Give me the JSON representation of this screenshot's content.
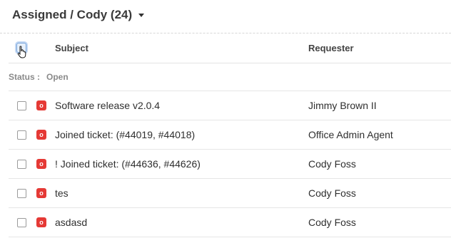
{
  "header": {
    "view_title": "Assigned / Cody (24)"
  },
  "columns": {
    "subject": "Subject",
    "requester": "Requester"
  },
  "group": {
    "label": "Status",
    "separator": ":",
    "value": "Open"
  },
  "rows": [
    {
      "status_badge": "o",
      "subject": "Software release v2.0.4",
      "requester": "Jimmy Brown II"
    },
    {
      "status_badge": "o",
      "subject": "Joined ticket: (#44019, #44018)",
      "requester": "Office Admin Agent"
    },
    {
      "status_badge": "o",
      "subject": "! Joined ticket: (#44636, #44626)",
      "requester": "Cody Foss"
    },
    {
      "status_badge": "o",
      "subject": "tes",
      "requester": "Cody Foss"
    },
    {
      "status_badge": "o",
      "subject": "asdasd",
      "requester": "Cody Foss"
    }
  ],
  "colors": {
    "status_open": "#e53935",
    "checkbox_focus": "#7aa6da"
  }
}
